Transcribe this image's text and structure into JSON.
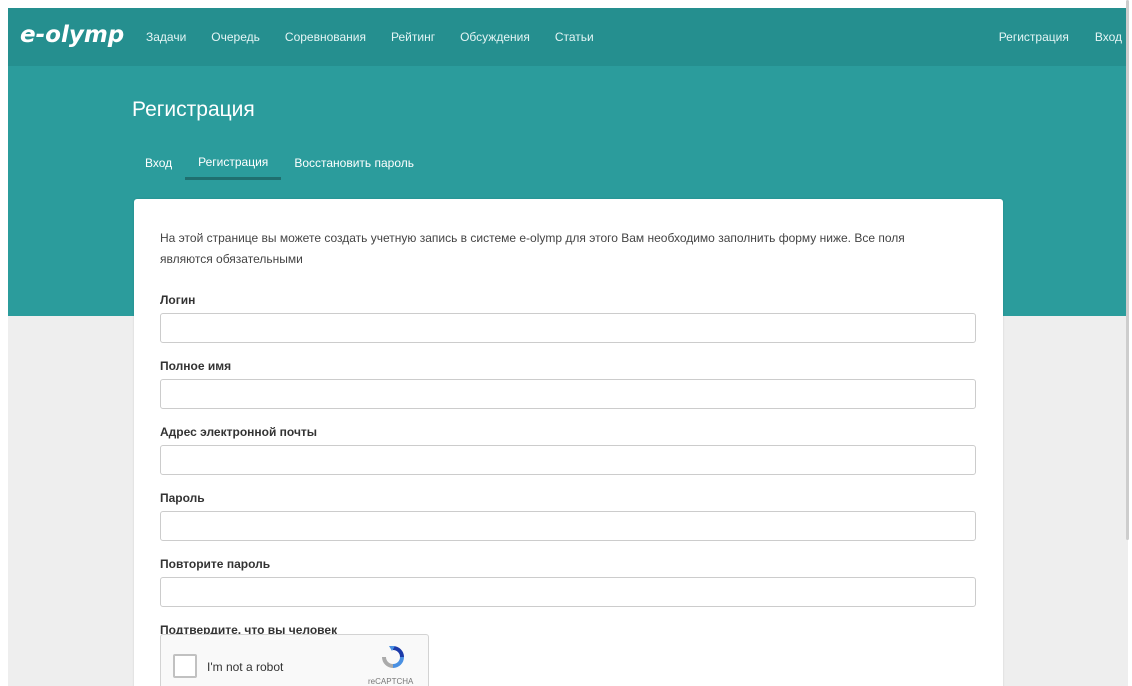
{
  "header": {
    "logo": "e-olymp",
    "nav_left": [
      "Задачи",
      "Очередь",
      "Соревнования",
      "Рейтинг",
      "Обсуждения",
      "Статьи"
    ],
    "nav_right": [
      "Регистрация",
      "Вход"
    ]
  },
  "hero": {
    "title": "Регистрация",
    "tabs": [
      {
        "label": "Вход",
        "active": false
      },
      {
        "label": "Регистрация",
        "active": true
      },
      {
        "label": "Восстановить пароль",
        "active": false
      }
    ]
  },
  "form": {
    "intro": "На этой странице вы можете создать учетную запись в системе e-olymp для этого Вам необходимо заполнить форму ниже. Все поля являются обязательными",
    "fields": [
      {
        "label": "Логин",
        "value": ""
      },
      {
        "label": "Полное имя",
        "value": ""
      },
      {
        "label": "Адрес электронной почты",
        "value": ""
      },
      {
        "label": "Пароль",
        "value": ""
      },
      {
        "label": "Повторите пароль",
        "value": ""
      }
    ],
    "captcha_label": "Подтвердите, что вы человек",
    "recaptcha": {
      "checkbox_text": "I'm not a robot",
      "brand": "reCAPTCHA"
    }
  },
  "colors": {
    "topbar": "#258f8f",
    "hero": "#2b9c9c",
    "page_bg": "#eeeeee",
    "tab_underline": "#1f6f6f"
  },
  "icons": {
    "recaptcha": "recaptcha-logo-icon"
  }
}
